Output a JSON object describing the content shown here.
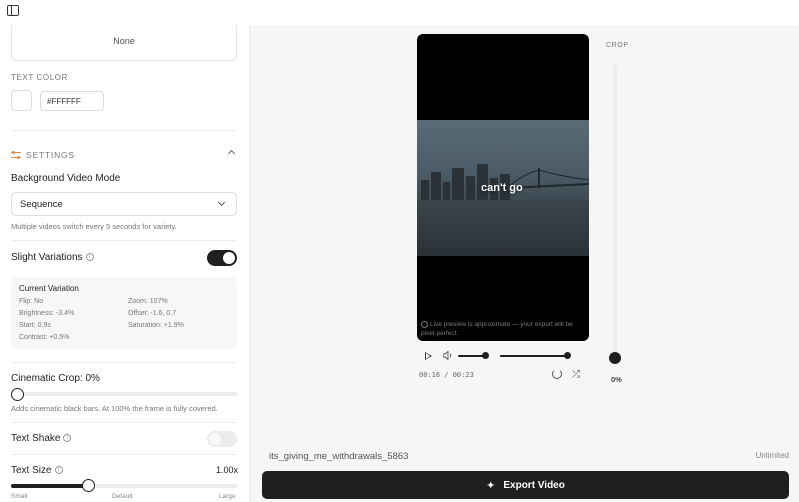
{
  "left_panel": {
    "font_box_value": "None",
    "text_color_label": "TEXT COLOR",
    "text_color_hex": "#FFFFFF",
    "settings_label": "SETTINGS",
    "bg_mode_label": "Background Video Mode",
    "bg_mode_value": "Sequence",
    "bg_mode_help": "Multiple videos switch every 5 seconds for variety.",
    "slight_variations_label": "Slight Variations",
    "slight_variations_on": true,
    "current_variation": {
      "title": "Current Variation",
      "flip": "Flip: No",
      "zoom": "Zoom: 107%",
      "brightness": "Brightness: -3.4%",
      "offset": "Offset: -1.6, 0.7",
      "start": "Start: 0.9s",
      "saturation": "Saturation: +1.9%",
      "contrast": "Contrast: +0.5%"
    },
    "cinematic_crop_label": "Cinematic Crop: 0%",
    "cinematic_crop_value": 0,
    "cinematic_crop_help": "Adds cinematic black bars. At 100% the frame is fully covered.",
    "text_shake_label": "Text Shake",
    "text_shake_on": false,
    "text_size_label": "Text Size",
    "text_size_value": "1.00x",
    "text_size_ticks": [
      "Small",
      "Default",
      "Large"
    ]
  },
  "preview": {
    "caption": "can't go",
    "note": "Live preview is approximate — your export will be pixel-perfect.",
    "time": "00:16 / 00:23",
    "crop_label": "CROP",
    "crop_value": "0%"
  },
  "footer": {
    "filename": "its_giving_me_withdrawals_5863",
    "plan": "Unlimited",
    "export_label": "Export Video"
  },
  "colors": {
    "accent": "#1f1f1f",
    "settings_icon": "#e08a4a"
  }
}
